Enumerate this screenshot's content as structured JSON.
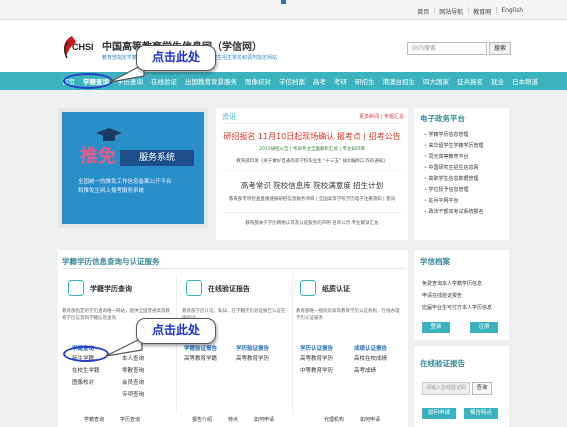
{
  "top_links": [
    "首页",
    "网站导航",
    "教育网",
    "English"
  ],
  "header": {
    "logo_abbr": "CHSI",
    "site_title": "中国高等教育学生信息网（学信网）",
    "site_sub": "教育部指定学籍查询与学历认证网站，全国硕士研究生招生报名和调剂指定网站",
    "search_placeholder": "站内搜索",
    "search_button": "搜索"
  },
  "nav": {
    "items": [
      "首页",
      "学籍查询",
      "学历查询",
      "在线验证",
      "出国教育背景服务",
      "图像校对",
      "学信档案",
      "高考",
      "考研",
      "研招生",
      "港澳台招生",
      "四大国家",
      "征兵报名",
      "就业",
      "日本频道"
    ],
    "active_index": 1
  },
  "callouts": {
    "top": "点击此处",
    "bottom": "点击此处"
  },
  "banner": {
    "tag": "推免",
    "tag2": "服务系统",
    "desc_line1": "全国统一的推免工作信息备案公开平台",
    "desc_line2": "和推免生网上报考服务系统"
  },
  "news": {
    "head": "资讯",
    "more1": "更多新闻",
    "more2": "专题汇总",
    "hl1": "研招报名  11月10日起现场确认  报考点  |  招考公告",
    "sm1": "2015研招公告  |  考研专业全面解析汇总  |  专业知识库",
    "sm2": "教育部印发《关于做好普通高等学校毕业生 “十三五” 规划编制工作的通知》",
    "mid": "高考常识  院校信息库  院校满意度  招生计划",
    "sm3": "教育部专项检查直播速报研招信息服务项目  |  全国高等学校学历电子注册须知  |  客问",
    "sm4": "教育部关于学历网络认可及认证服务的声明  名单公示  专业解读汇总"
  },
  "eservice": {
    "title": "电子政务平台",
    "items": [
      "学籍学历信息管理",
      "来华留学生学籍学历管理",
      "同光高等教育平台",
      "中国研究生招生信息网",
      "高职学生信息数据管理",
      "学位授予信息管理",
      "征兵平网平台",
      "政法干部双考试系统报名"
    ]
  },
  "xueli": {
    "title": "学籍学历信息查询与认证服务",
    "col1": {
      "title": "学籍学历查询",
      "desc": "教育部指定的学历查询唯一网站，提供全国普通高等教育学历信息和学籍信息查询",
      "head_links": [
        "学籍查询",
        "本人查询"
      ],
      "links": [
        "新生学籍",
        "在校生学籍",
        "图像校对",
        "零散查询",
        "会员查询",
        "专项查询"
      ],
      "footer": [
        "学籍查询",
        "学历查询"
      ]
    },
    "col2": {
      "title": "在线验证报告",
      "desc": "教育部学历认证，私知，在学籍学历验证报告认证在线验证",
      "head_links": [
        "学籍验证报告",
        "学历验证报告"
      ],
      "links": [
        "高等教育学籍",
        "高等教育学历"
      ],
      "footer": [
        "报告介绍",
        "特点",
        "如何申请"
      ]
    },
    "col3": {
      "title": "纸质认证",
      "desc": "教育部唯一授权的高等教育学历认证机构，在线办理学历认证服务",
      "head_links": [
        "学历认证报告",
        "成绩认证报告"
      ],
      "links": [
        "高等教育学历",
        "高校在校成绩",
        "中等教育学历",
        "高考成绩"
      ],
      "footer": [
        "代理机构",
        "如何申请"
      ]
    }
  },
  "archive": {
    "title": "学信档案",
    "lines": [
      "免费查询本人学籍学历信息",
      "申请在线验证报告",
      "应届毕业生可付方本人学历信息"
    ],
    "login": "登录",
    "register": "注册"
  },
  "online": {
    "title": "在线验证报告",
    "input_placeholder": "请输入在线验证码",
    "query_button": "查询",
    "apply": "如何申请",
    "features": "报告特点"
  },
  "colors": {
    "teal": "#3bb3be",
    "callout_text": "#1c2fc9",
    "oval": "#2a3fc9"
  }
}
